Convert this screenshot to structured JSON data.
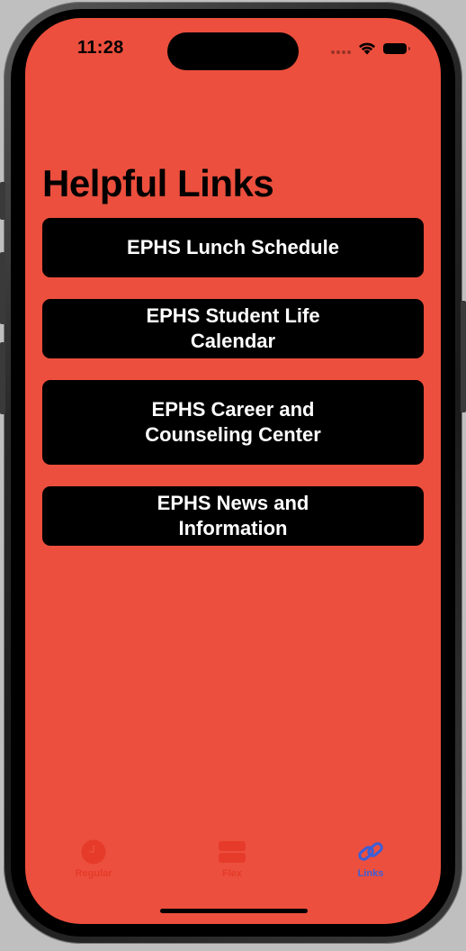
{
  "status_bar": {
    "time": "11:28"
  },
  "page": {
    "title": "Helpful Links"
  },
  "links": [
    {
      "label": "EPHS Lunch Schedule"
    },
    {
      "label": "EPHS Student Life Calendar"
    },
    {
      "label": "EPHS Career and Counseling Center"
    },
    {
      "label": "EPHS News and Information"
    }
  ],
  "tabs": [
    {
      "label": "Regular",
      "icon": "clock-icon",
      "active": false
    },
    {
      "label": "Flex",
      "icon": "stack-icon",
      "active": false
    },
    {
      "label": "Links",
      "icon": "link-icon",
      "active": true
    }
  ],
  "colors": {
    "background": "#ec4f3d",
    "button": "#000000",
    "tab_inactive": "#e63b2b",
    "tab_active": "#3c5fd6"
  }
}
